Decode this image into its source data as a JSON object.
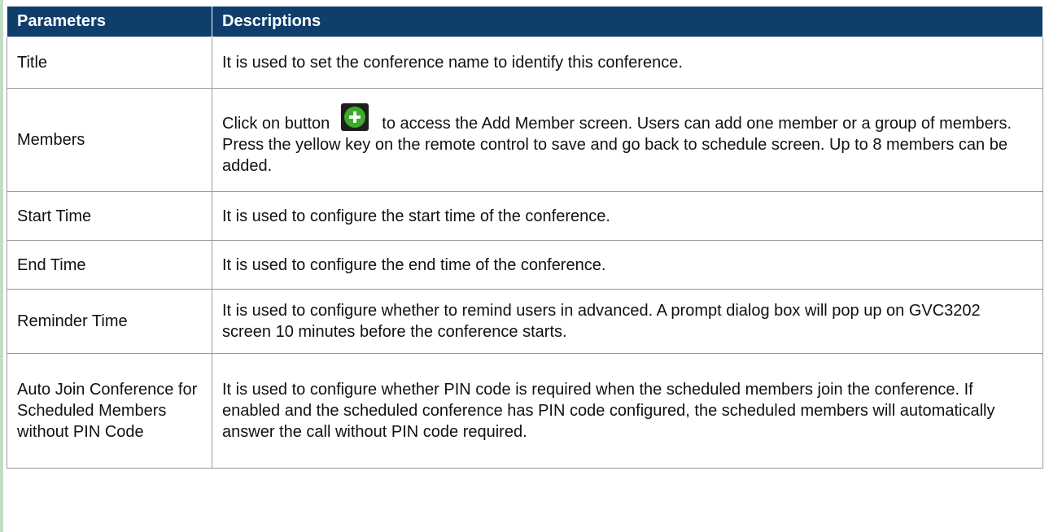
{
  "table": {
    "headers": {
      "parameters": "Parameters",
      "descriptions": "Descriptions"
    },
    "rows": [
      {
        "parameter": "Title",
        "description": "It is used to set the conference name to identify this conference."
      },
      {
        "parameter": "Members",
        "description_before_icon": "Click on button",
        "icon": "add-plus-icon",
        "description_after_icon": "to access the Add Member screen. Users can add one member or a group of members. Press the yellow key on the remote control to save and go back to schedule screen. Up to 8 members can be added."
      },
      {
        "parameter": "Start Time",
        "description": "It is used to configure the start time of the conference."
      },
      {
        "parameter": "End Time",
        "description": "It is used to configure the end time of the conference."
      },
      {
        "parameter": "Reminder Time",
        "description": "It is used to configure whether to remind users in advanced. A prompt dialog box will pop up on GVC3202 screen 10 minutes before the conference starts."
      },
      {
        "parameter": "Auto Join Conference for Scheduled Members without PIN Code",
        "description": "It is used to configure whether PIN code is required when the scheduled members join the conference. If enabled and the scheduled conference has PIN code configured, the scheduled members will automatically answer the call without PIN code required."
      }
    ]
  },
  "colors": {
    "header_background": "#0f3e6b",
    "header_text": "#ffffff",
    "icon_green": "#3caa2a",
    "left_rule": "#c3dcc6"
  }
}
